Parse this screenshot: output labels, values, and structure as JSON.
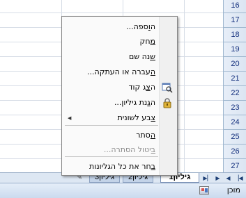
{
  "row_numbers": [
    "16",
    "17",
    "18",
    "19",
    "20",
    "21",
    "22",
    "23",
    "24",
    "25",
    "26",
    "27"
  ],
  "context_menu": {
    "items": [
      {
        "key": "insert",
        "pre": "ה",
        "ul": "ו",
        "post": "ספה...",
        "enabled": true
      },
      {
        "key": "delete",
        "pre": "",
        "ul": "מ",
        "post": "חק",
        "enabled": true
      },
      {
        "key": "rename",
        "pre": "",
        "ul": "ש",
        "post": "נה שם",
        "enabled": true
      },
      {
        "key": "move_copy",
        "pre": "",
        "ul": "ה",
        "post": "עברה או העתקה...",
        "enabled": true
      },
      {
        "key": "view_code",
        "pre": "ה",
        "ul": "צ",
        "post": "ג קוד",
        "enabled": true,
        "icon": "view-code-icon"
      },
      {
        "key": "protect_sheet",
        "pre": "ה",
        "ul": "ג",
        "post": "נת גיליון...",
        "enabled": true,
        "icon": "lock-icon"
      },
      {
        "key": "tab_color",
        "pre": "",
        "ul": "צ",
        "post": "בע לשונית",
        "enabled": true,
        "submenu": true
      },
      {
        "key": "hide",
        "pre": "",
        "ul": "ה",
        "post": "סתר",
        "enabled": true
      },
      {
        "key": "unhide",
        "pre": "",
        "ul": "ב",
        "post": "יטול הסתרה...",
        "enabled": false
      },
      {
        "key": "select_all",
        "pre": "",
        "ul": "ב",
        "post": "חר את כל הגליונות",
        "enabled": true
      }
    ]
  },
  "sheet_tabs": [
    {
      "label": "גיליון1",
      "active": true
    },
    {
      "label": "גיליון2",
      "active": false
    },
    {
      "label": "גיליון3",
      "active": false
    }
  ],
  "nav_buttons": [
    "first-sheet",
    "prev-sheet",
    "next-sheet",
    "last-sheet"
  ],
  "status": {
    "text": "מוכן"
  },
  "colors": {
    "row_header_text": "#15317e",
    "gridline": "#d6dce6",
    "menu_border": "#868686"
  }
}
